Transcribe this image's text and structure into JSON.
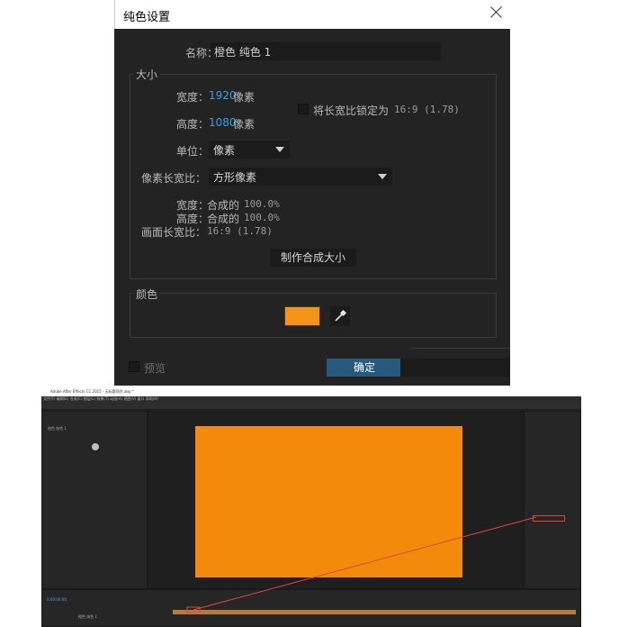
{
  "dialog": {
    "title": "纯色设置",
    "name_label": "名称：",
    "name_value": "橙色 纯色 1",
    "size_group_label": "大小",
    "width_label": "宽度：",
    "width_value": "1920",
    "width_unit": "像素",
    "height_label": "高度：",
    "height_value": "1080",
    "height_unit": "像素",
    "lock_aspect_label": "将长宽比锁定为",
    "lock_aspect_value": "16:9 (1.78)",
    "units_label": "单位：",
    "units_value": "像素",
    "pixel_aspect_label": "像素长宽比：",
    "pixel_aspect_value": "方形像素",
    "width_pct_label": "宽度：",
    "width_pct_prefix": "合成的",
    "width_pct_value": "100.0%",
    "height_pct_label": "高度：",
    "height_pct_prefix": "合成的",
    "height_pct_value": "100.0%",
    "frame_aspect_label": "画面长宽比：",
    "frame_aspect_value": "16:9 (1.78)",
    "make_comp_size_button": "制作合成大小",
    "color_group_label": "颜色",
    "color_value": "#f49317",
    "preview_label": "预览",
    "ok_button": "确定"
  },
  "ae": {
    "title": "Adobe After Effects CC 2015 - 无标题项目.aep *",
    "menu": "文件(F)  编辑(E)  合成(C)  图层(L)  效果(T)  动画(A)  视图(V)  窗口  帮助(H)",
    "layer_name": "橙色 纯色 1",
    "timecode": "0:00:00:00",
    "comp_color": "#f38a0c",
    "highlight_color": "#e2463b"
  }
}
